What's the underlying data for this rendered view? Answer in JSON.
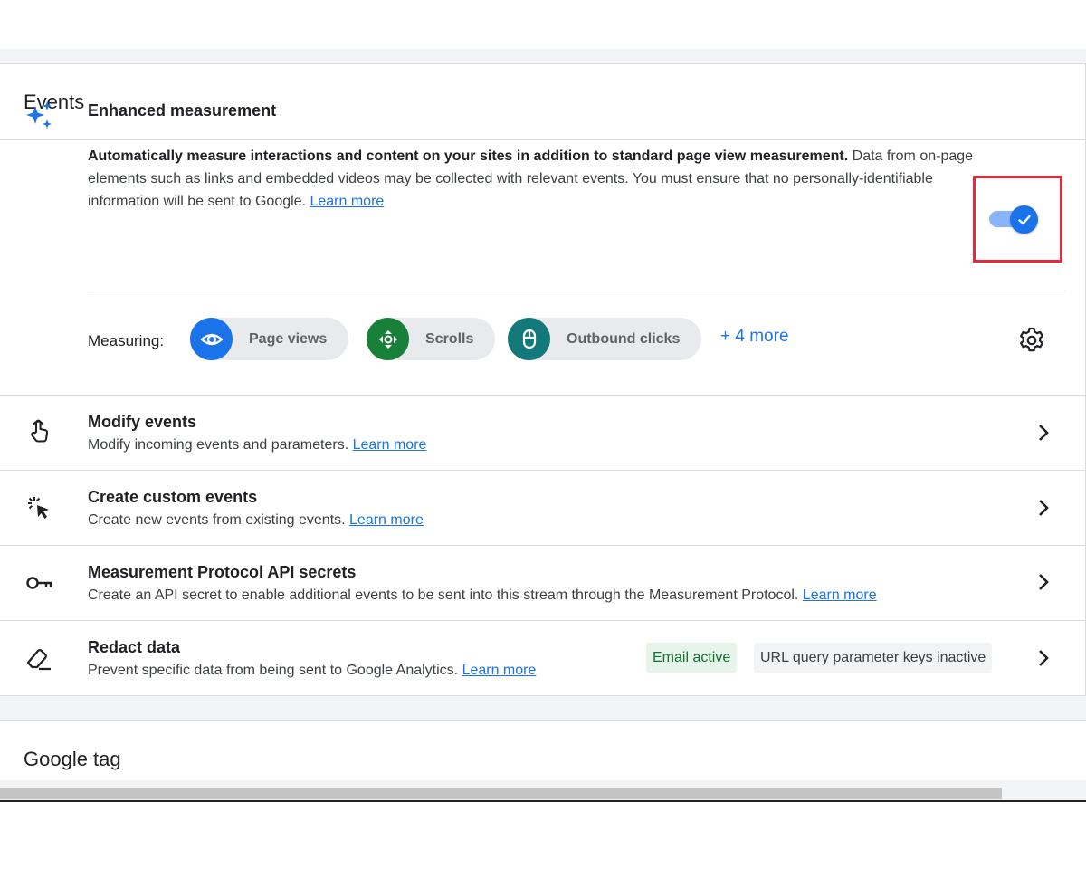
{
  "events_card": {
    "title": "Events",
    "enhanced": {
      "title": "Enhanced measurement",
      "desc_bold": "Automatically measure interactions and content on your sites in addition to standard page view measurement.",
      "desc_rest": "Data from on-page elements such as links and embedded videos may be collected with relevant events. You must ensure that no personally-identifiable information will be sent to Google.",
      "learn_more": "Learn more",
      "toggle_on": true,
      "measuring_label": "Measuring:",
      "chips": [
        {
          "label": "Page views",
          "icon": "eye-icon",
          "color": "#1a73e8"
        },
        {
          "label": "Scrolls",
          "icon": "scroll-arrows-icon",
          "color": "#188038"
        },
        {
          "label": "Outbound clicks",
          "icon": "mouse-icon",
          "color": "#12787a"
        }
      ],
      "more_label": "+ 4 more",
      "settings_icon": "gear-icon"
    },
    "rows": [
      {
        "title": "Modify events",
        "desc": "Modify incoming events and parameters.",
        "learn_more": "Learn more",
        "icon": "touch-hand-icon"
      },
      {
        "title": "Create custom events",
        "desc": "Create new events from existing events.",
        "learn_more": "Learn more",
        "icon": "click-sparkle-icon"
      },
      {
        "title": "Measurement Protocol API secrets",
        "desc": "Create an API secret to enable additional events to be sent into this stream through the Measurement Protocol.",
        "learn_more": "Learn more",
        "icon": "key-icon"
      },
      {
        "title": "Redact data",
        "desc": "Prevent specific data from being sent to Google Analytics.",
        "learn_more": "Learn more",
        "icon": "eraser-icon",
        "badges": [
          {
            "label": "Email active",
            "kind": "active"
          },
          {
            "label": "URL query parameter keys inactive",
            "kind": "inactive"
          }
        ]
      }
    ]
  },
  "google_tag": {
    "title": "Google tag"
  },
  "colors": {
    "accent": "#1a73e8",
    "highlight_box": "#e8283a"
  }
}
